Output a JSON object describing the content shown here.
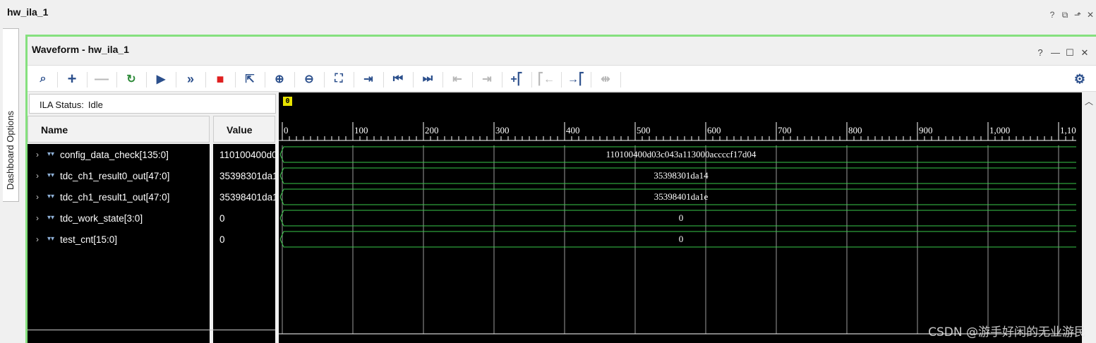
{
  "app": {
    "title": "hw_ila_1"
  },
  "dashboard_tab": {
    "label": "Dashboard Options"
  },
  "panel": {
    "title": "Waveform - hw_ila_1"
  },
  "toolbar": {
    "icons": [
      "search-icon",
      "add-icon",
      "remove-icon",
      "refresh-icon",
      "run-trigger-icon",
      "run-immediate-icon",
      "stop-icon",
      "export-icon",
      "zoom-in-icon",
      "zoom-out-icon",
      "zoom-fit-icon",
      "goto-cursor-icon",
      "goto-start-icon",
      "goto-end-icon",
      "previous-transition-icon",
      "next-transition-icon",
      "add-marker-icon",
      "previous-marker-icon",
      "next-marker-icon",
      "swap-cursors-icon",
      "settings-icon"
    ]
  },
  "status": {
    "label": "ILA Status:",
    "value": "Idle"
  },
  "columns": {
    "name": "Name",
    "value": "Value"
  },
  "signals": [
    {
      "name": "config_data_check[135:0]",
      "value": "110100400d03c043a113000accccf17d04",
      "wave": "110100400d03c043a113000accccf17d04"
    },
    {
      "name": "tdc_ch1_result0_out[47:0]",
      "value": "35398301da14",
      "wave": "35398301da14"
    },
    {
      "name": "tdc_ch1_result1_out[47:0]",
      "value": "35398401da1e",
      "wave": "35398401da1e"
    },
    {
      "name": "tdc_work_state[3:0]",
      "value": "0",
      "wave": "0"
    },
    {
      "name": "test_cnt[15:0]",
      "value": "0",
      "wave": "0"
    }
  ],
  "timeline": {
    "cursor_label": "0",
    "axis_labels": [
      "0",
      "100",
      "200",
      "300",
      "400",
      "500",
      "600",
      "700",
      "800",
      "900",
      "1,000",
      "1,10"
    ]
  },
  "watermark": "CSDN @游手好闲的无业游民",
  "colors": {
    "panel_border": "#85e07e",
    "wave": "#39c84a",
    "cursor": "#e8e400"
  }
}
